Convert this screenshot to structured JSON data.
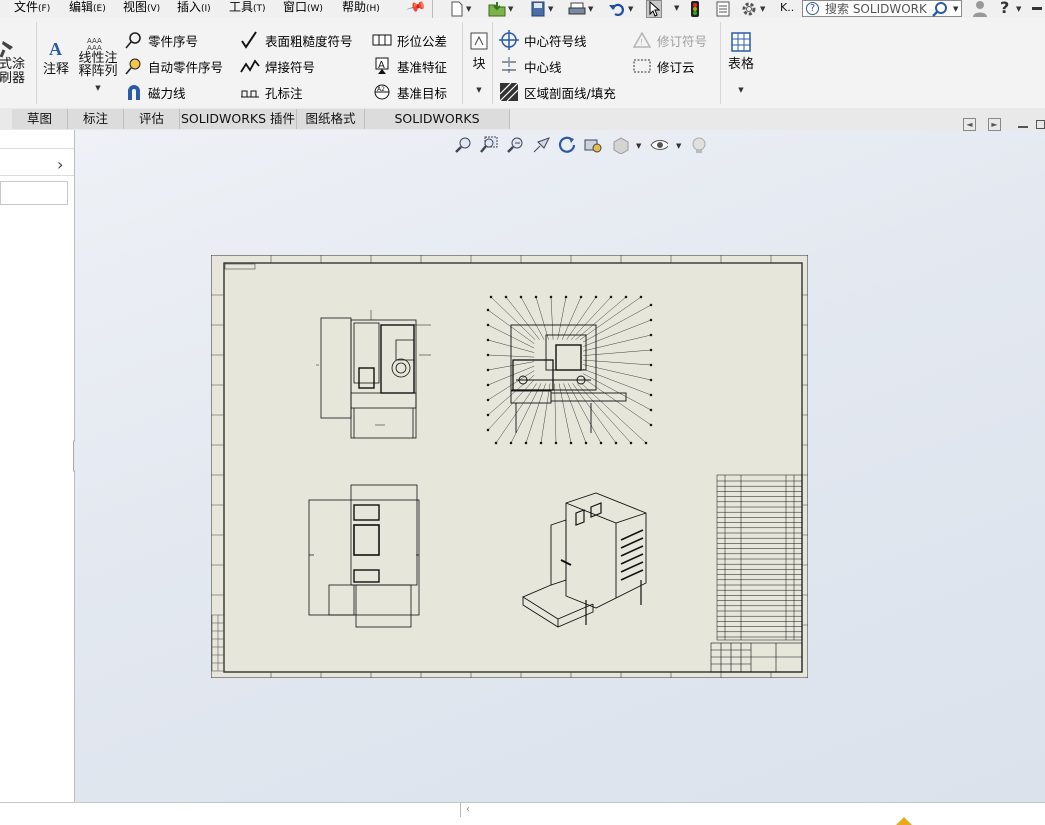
{
  "menubar": {
    "items": [
      {
        "label": "文件",
        "key": "(F)"
      },
      {
        "label": "编辑",
        "key": "(E)"
      },
      {
        "label": "视图",
        "key": "(V)"
      },
      {
        "label": "插入",
        "key": "(I)"
      },
      {
        "label": "工具",
        "key": "(T)"
      },
      {
        "label": "窗口",
        "key": "(W)"
      },
      {
        "label": "帮助",
        "key": "(H)"
      }
    ],
    "doc_label": "K..",
    "search_placeholder": "搜索 SOLIDWORKS",
    "help_glyph": "?"
  },
  "ribbon": {
    "left_cut_line1": "式涂",
    "left_cut_line2": "刷器",
    "annotation": "注释",
    "linear_pattern_line1": "线性注",
    "linear_pattern_line2": "释阵列",
    "balloon": "零件序号",
    "auto_balloon": "自动零件序号",
    "magnetic_line": "磁力线",
    "surface_finish": "表面粗糙度符号",
    "weld_symbol": "焊接符号",
    "hole_callout": "孔标注",
    "gdt": "形位公差",
    "datum_feature": "基准特征",
    "datum_target": "基准目标",
    "block": "块",
    "center_mark": "中心符号线",
    "centerline": "中心线",
    "area_hatch": "区域剖面线/填充",
    "revision_symbol": "修订符号",
    "revision_cloud": "修订云",
    "table": "表格"
  },
  "tabs": [
    {
      "label": "草图"
    },
    {
      "label": "标注"
    },
    {
      "label": "评估"
    },
    {
      "label": "SOLIDWORKS 插件"
    },
    {
      "label": "图纸格式"
    },
    {
      "label": "SOLIDWORKS Inspection"
    }
  ],
  "colors": {
    "accent": "#2b5aa8",
    "sheet": "#e6e6dc",
    "canvas": "#e3e8f0"
  }
}
